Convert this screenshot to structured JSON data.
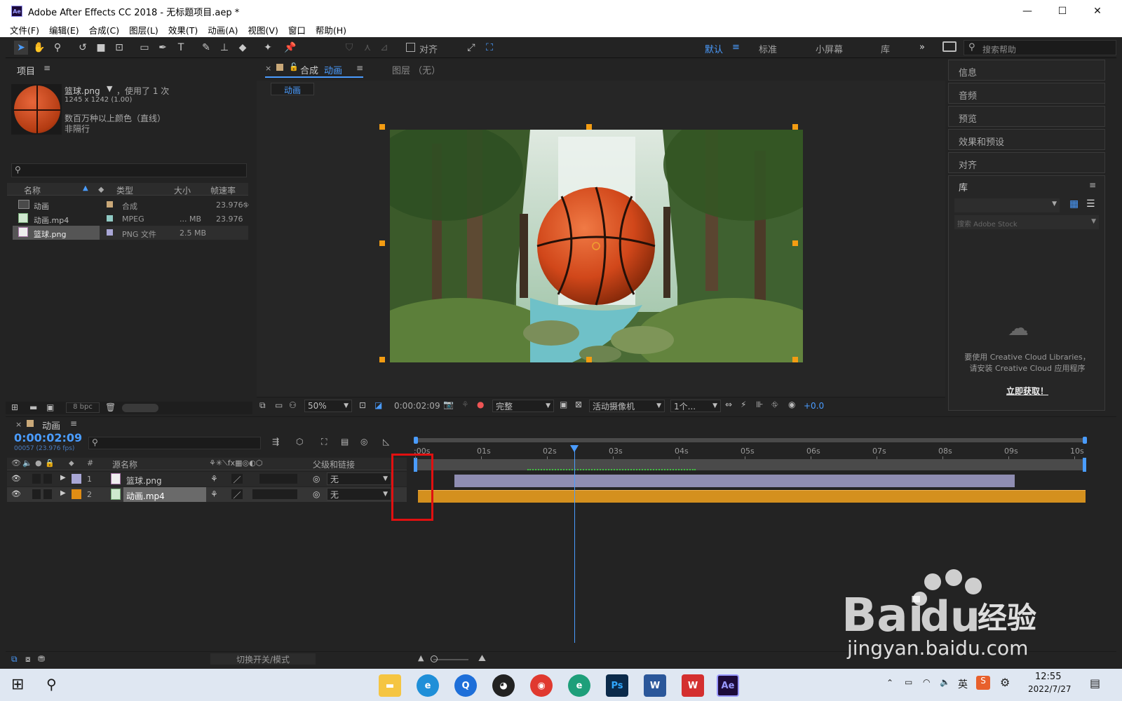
{
  "window": {
    "title": "Adobe After Effects CC 2018 - 无标题项目.aep *",
    "minimize": "—",
    "maximize": "☐",
    "close": "✕"
  },
  "menu": [
    "文件(F)",
    "编辑(E)",
    "合成(C)",
    "图层(L)",
    "效果(T)",
    "动画(A)",
    "视图(V)",
    "窗口",
    "帮助(H)"
  ],
  "toolbar": {
    "align_label": "对齐",
    "workspaces": [
      "默认",
      "标准",
      "小屏幕",
      "库"
    ],
    "more": "»",
    "search_placeholder": "搜索帮助"
  },
  "project": {
    "title": "项目",
    "selected_name": "篮球.png",
    "used": "，使用了 1 次",
    "dims": "1245 x 1242 (1.00)",
    "color_info": "数百万种以上颜色（直线）",
    "interlace": "非隔行",
    "columns": [
      "名称",
      "类型",
      "大小",
      "帧速率"
    ],
    "items": [
      {
        "name": "动画",
        "type": "合成",
        "size": "",
        "fps": "23.976"
      },
      {
        "name": "动画.mp4",
        "type": "MPEG",
        "size": "... MB",
        "fps": "23.976"
      },
      {
        "name": "篮球.png",
        "type": "PNG 文件",
        "size": "2.5 MB",
        "fps": ""
      }
    ],
    "bpc": "8 bpc"
  },
  "viewer": {
    "comp_tab_prefix": "合成",
    "comp_tab_name": "动画",
    "layer_tab": "图层 （无）",
    "breadcrumb": "动画",
    "zoom": "50%",
    "timecode": "0:00:02:09",
    "quality": "完整",
    "camera": "活动摄像机",
    "views": "1个...",
    "exposure": "+0.0"
  },
  "right_panels": {
    "items": [
      "信息",
      "音频",
      "预览",
      "效果和预设",
      "对齐"
    ],
    "library_title": "库",
    "library_search": "搜索 Adobe Stock",
    "cc_message_1": "要使用 Creative Cloud Libraries，",
    "cc_message_2": "请安装 Creative Cloud 应用程序",
    "cc_link": "立即获取！"
  },
  "timeline": {
    "comp_name": "动画",
    "timecode": "0:00:02:09",
    "frames": "00057 (23.976 fps)",
    "col_num": "#",
    "col_source": "源名称",
    "col_parent": "父级和链接",
    "ticks": [
      ":00s",
      "01s",
      "02s",
      "03s",
      "04s",
      "05s",
      "06s",
      "07s",
      "08s",
      "09s",
      "10s"
    ],
    "current_time_s": 2.375,
    "duration_s": 10.3,
    "layers": [
      {
        "num": "1",
        "name": "篮球.png",
        "parent": "无",
        "label_color": "#a9a7d6",
        "bar_start_s": 0.55,
        "bar_end_s": 9.05
      },
      {
        "num": "2",
        "name": "动画.mp4",
        "parent": "无",
        "label_color": "#e08d14",
        "bar_start_s": 0.0,
        "bar_end_s": 10.3
      }
    ],
    "toggle_label": "切换开关/模式"
  },
  "taskbar": {
    "ime": "英",
    "time": "12:55",
    "date": "2022/7/27"
  },
  "watermark": {
    "text": "jingyan.baidu.com",
    "brand_suffix": "经验"
  }
}
